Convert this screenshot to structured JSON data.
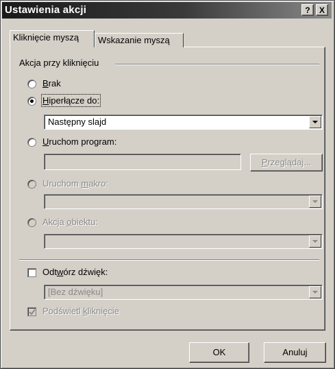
{
  "window": {
    "title": "Ustawienia akcji",
    "help": "?",
    "close": "X"
  },
  "tabs": [
    {
      "pre": "Kliknięcie myszą",
      "active": true
    },
    {
      "pre": "Wskazanie myszą",
      "active": false
    }
  ],
  "group": {
    "label": "Akcja przy kliknięciu"
  },
  "options": {
    "none": {
      "u": "B",
      "rest": "rak"
    },
    "hyperlink": {
      "pre": "",
      "u": "H",
      "rest": "iperłącze do:",
      "value": "Następny slajd"
    },
    "run_program": {
      "u": "U",
      "rest": "ruchom program:",
      "value": "",
      "browse_pre": "",
      "browse_u": "P",
      "browse_rest": "rzeglądaj..."
    },
    "run_macro": {
      "pre": "Uruchom ",
      "u": "m",
      "rest": "akro:",
      "value": ""
    },
    "object_action": {
      "pre": "Akcja ",
      "u": "o",
      "rest": "biektu:",
      "value": ""
    }
  },
  "play_sound": {
    "pre": "Odt",
    "u": "w",
    "rest": "órz dźwięk:",
    "value": "[Bez dźwięku]",
    "checked": false
  },
  "highlight": {
    "pre": "Podświetl ",
    "u": "k",
    "rest": "liknięcie",
    "checked": true
  },
  "buttons": {
    "ok": "OK",
    "cancel": "Anuluj"
  }
}
